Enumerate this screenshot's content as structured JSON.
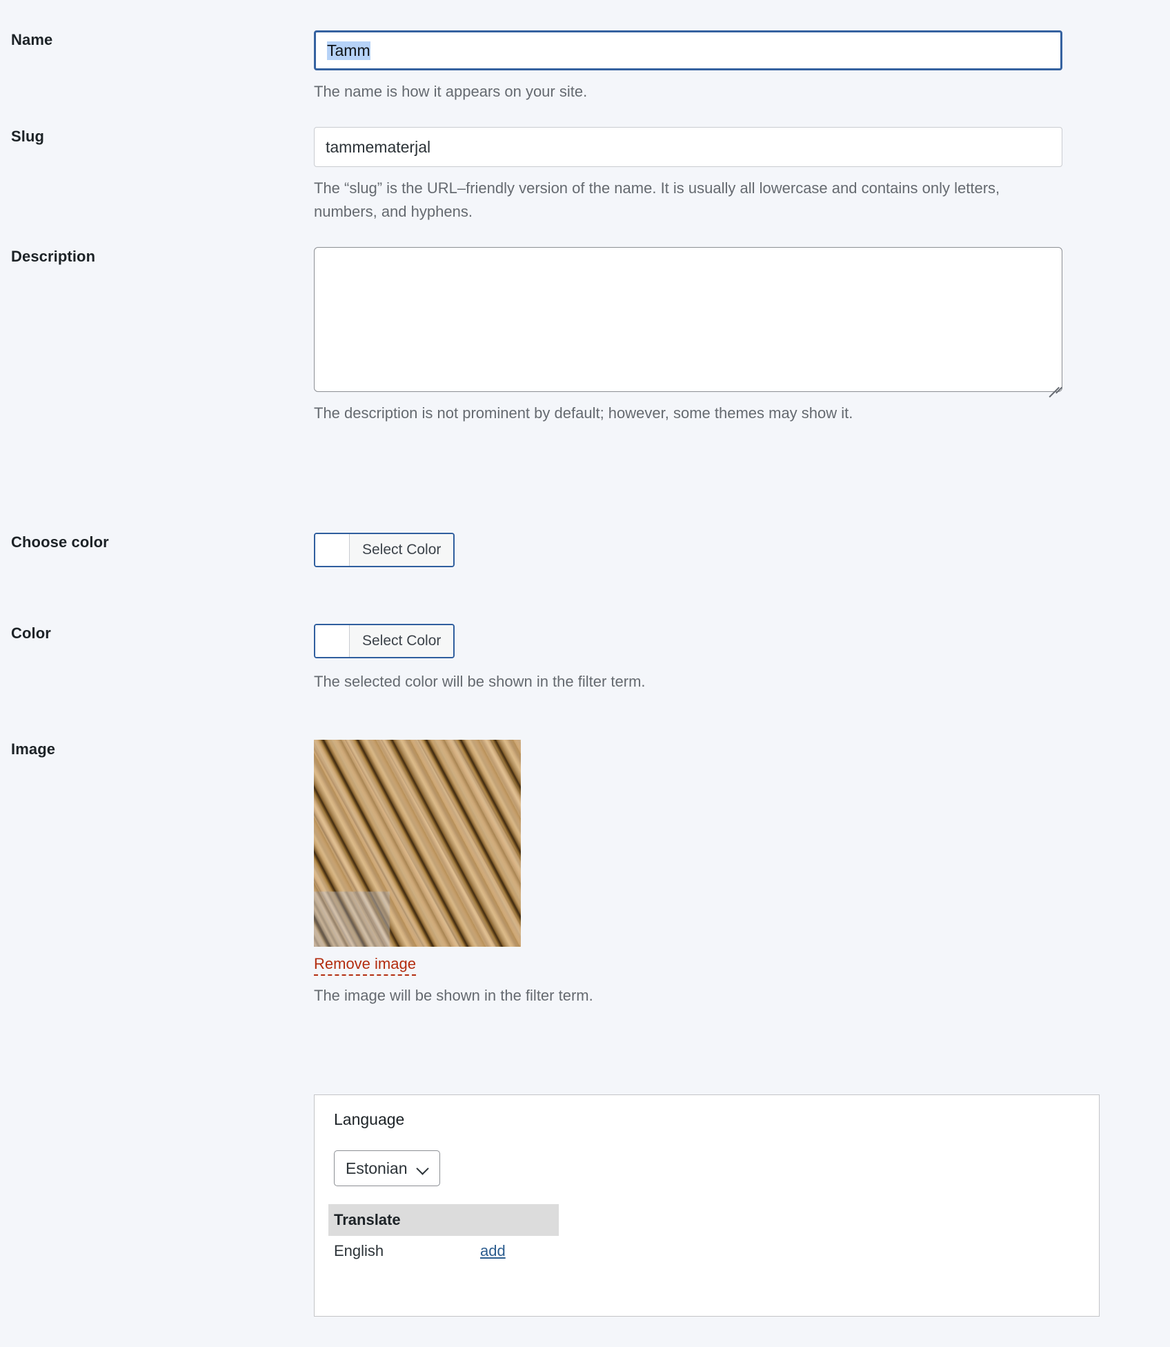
{
  "form": {
    "fields": [
      {
        "label": "Name",
        "value": "Tamm",
        "value_selected": true,
        "help": "The name is how it appears on your site."
      },
      {
        "label": "Slug",
        "value": "tammematerjal",
        "help": "The “slug” is the URL–friendly version of the name. It is usually all lowercase and contains only letters, numbers, and hyphens."
      },
      {
        "label": "Description",
        "value": "",
        "help": "The description is not prominent by default; however, some themes may show it."
      },
      {
        "label": "Choose color",
        "button_label": "Select Color",
        "swatch_color": "#ffffff",
        "help": ""
      },
      {
        "label": "Color",
        "button_label": "Select Color",
        "swatch_color": "#ffffff",
        "help": "The selected color will be shown in the filter term."
      },
      {
        "label": "Image",
        "remove_label": "Remove image",
        "help": "The image will be shown in the filter term."
      }
    ]
  },
  "language_panel": {
    "title": "Language",
    "selected_language": "Estonian",
    "translate_header": "Translate",
    "rows": [
      {
        "language": "English",
        "action": "add"
      }
    ]
  },
  "colors": {
    "page_background": "#f4f6fa",
    "focus_border": "#3562a0",
    "help_text": "#656a70",
    "remove_link": "#b32d0f",
    "add_link": "#2c5d8f",
    "translate_header_bg": "#dcdcdc",
    "selection_highlight": "#b6d2f7"
  }
}
